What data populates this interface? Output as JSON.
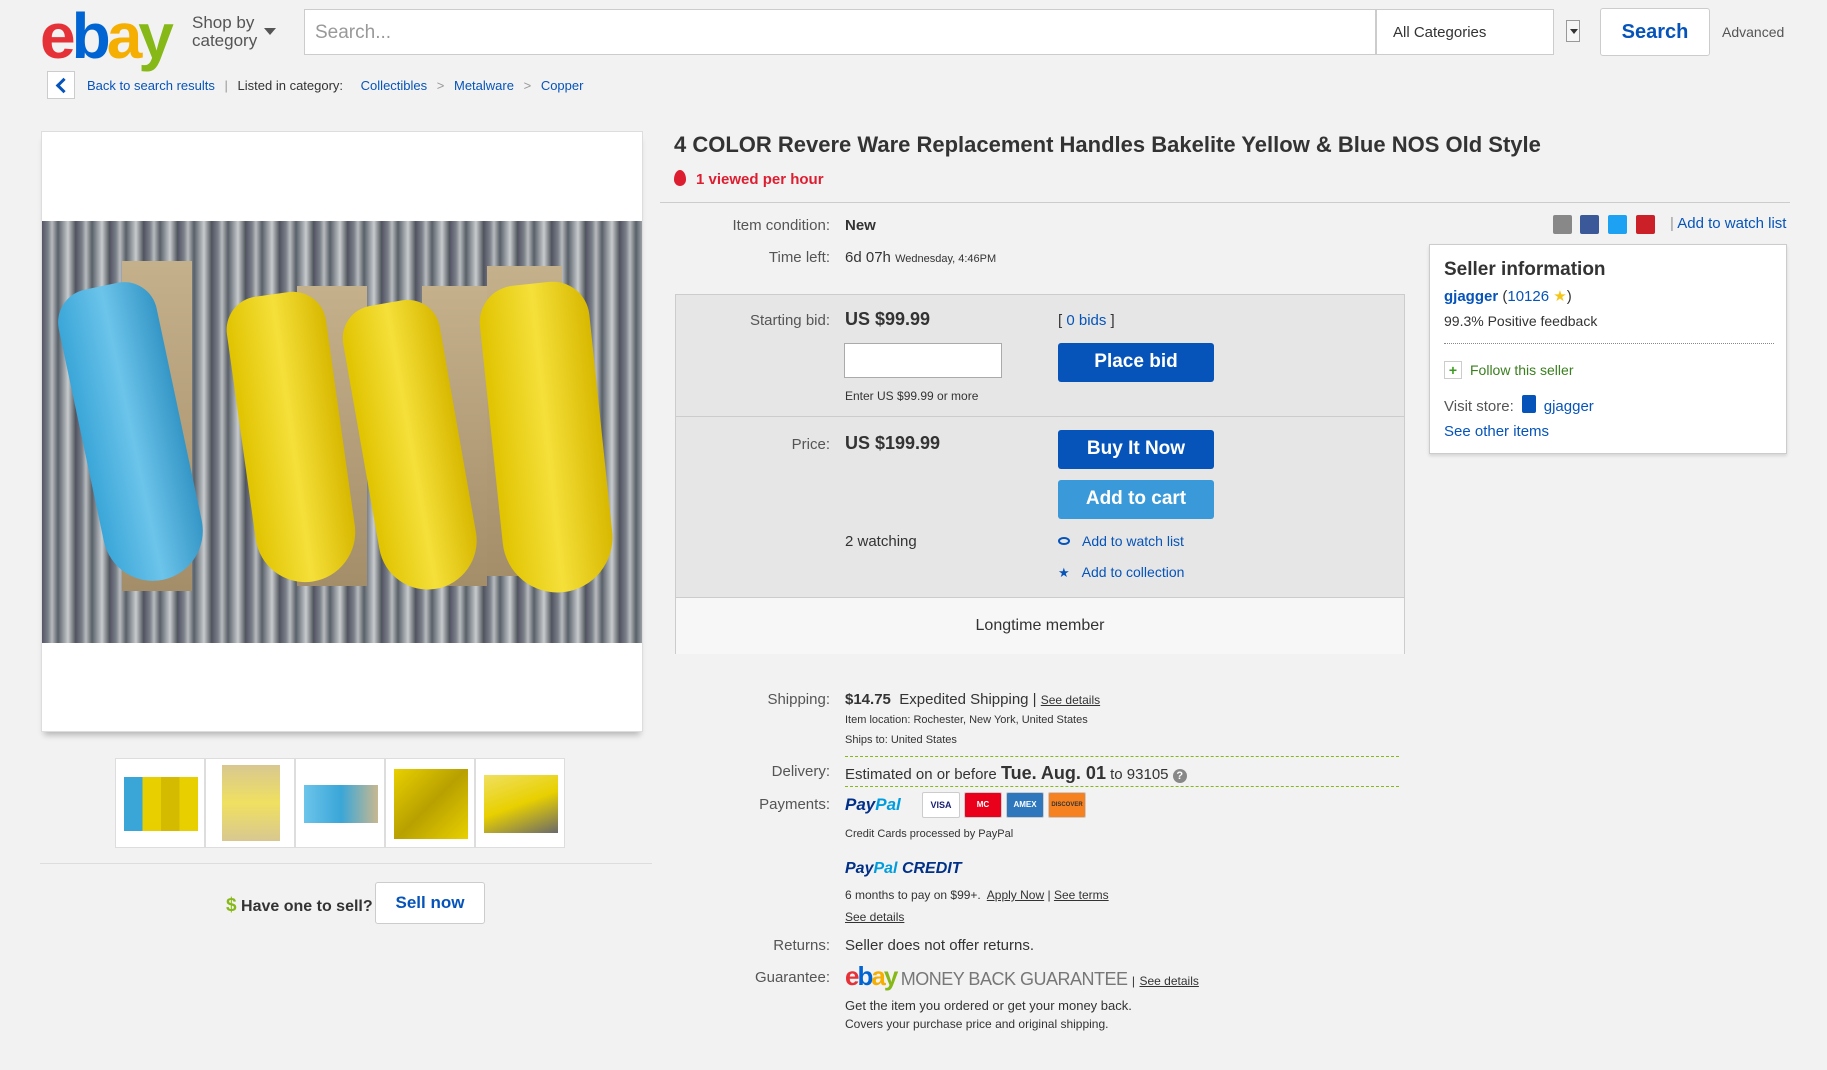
{
  "header": {
    "logo": [
      "e",
      "b",
      "a",
      "y"
    ],
    "shop_by": "Shop by",
    "category": "category",
    "search_placeholder": "Search...",
    "category_select": "All Categories",
    "search_button": "Search",
    "advanced": "Advanced"
  },
  "breadcrumb": {
    "back": "Back to search results",
    "listed_in": "Listed in category:",
    "items": [
      "Collectibles",
      "Metalware",
      "Copper"
    ],
    "separator": ">"
  },
  "listing": {
    "title": "4 COLOR Revere Ware Replacement Handles Bakelite Yellow & Blue NOS Old Style",
    "viewed": "1 viewed per hour",
    "condition_label": "Item condition:",
    "condition_value": "New",
    "time_left_label": "Time left:",
    "time_left_value": "6d 07h",
    "time_left_end": "Wednesday, 4:46PM",
    "add_to_watch_list": "Add to watch list"
  },
  "bidding": {
    "starting_bid_label": "Starting bid:",
    "starting_bid": "US $99.99",
    "bids_open": "[",
    "bids": "0 bids",
    "bids_close": "]",
    "bid_hint": "Enter US $99.99 or more",
    "place_bid": "Place bid",
    "price_label": "Price:",
    "price": "US $199.99",
    "buy_it_now": "Buy It Now",
    "add_to_cart": "Add to cart",
    "watching": "2 watching",
    "add_to_watch_list": "Add to watch list",
    "add_to_collection": "Add to collection",
    "longtime": "Longtime member"
  },
  "seller": {
    "title": "Seller information",
    "name": "gjagger",
    "feedback_open": " (",
    "feedback_score": "10126",
    "feedback_close": ")",
    "positive": "99.3% Positive feedback",
    "follow": "Follow this seller",
    "visit_store": "Visit store:",
    "store_name": "gjagger",
    "other_items": "See other items"
  },
  "shipping": {
    "label": "Shipping:",
    "cost": "$14.75",
    "method": "Expedited Shipping",
    "pipe": "|",
    "see_details": "See details",
    "item_location": "Item location:  Rochester, New York, United States",
    "ships_to": "Ships to:  United States"
  },
  "delivery": {
    "label": "Delivery:",
    "prefix": "Estimated on or before",
    "date": "Tue. Aug. 01",
    "suffix": "to 93105",
    "help": "?"
  },
  "payments": {
    "label": "Payments:",
    "paypal_a": "Pay",
    "paypal_b": "Pal",
    "cards": [
      "VISA",
      "MC",
      "AMEX",
      "DISCOVER"
    ],
    "processed": "Credit Cards processed by PayPal",
    "credit_a": "Pay",
    "credit_b": "Pal",
    "credit_c": "CREDIT",
    "months": "6 months to pay on $99+.",
    "apply": "Apply Now",
    "pipe": "|",
    "see_terms": "See terms",
    "see_details": "See details"
  },
  "returns": {
    "label": "Returns:",
    "value": "Seller does not offer returns."
  },
  "guarantee": {
    "label": "Guarantee:",
    "mbg": "MONEY BACK GUARANTEE",
    "pipe": "|",
    "see_details": "See details",
    "line1": "Get the item you ordered or get your money back.",
    "line2": "Covers your purchase price and original shipping."
  },
  "sell": {
    "dollar": "$",
    "have_one": "Have one to sell?",
    "sell_now": "Sell now"
  },
  "colors": {
    "ebay_red": "#e53238",
    "ebay_blue": "#0064d2",
    "ebay_yellow": "#f5af02",
    "ebay_green": "#86b817",
    "link_blue": "#0654ba",
    "button_blue": "#0654ba",
    "cart_blue": "#3a9ad9",
    "viewed_red": "#dd1e31"
  },
  "icons": [
    "chevron-left-icon",
    "caret-down-icon",
    "flame-icon",
    "email-icon",
    "facebook-icon",
    "twitter-icon",
    "pinterest-icon",
    "eye-icon",
    "star-icon",
    "plus-icon",
    "store-icon",
    "help-icon",
    "dollar-icon"
  ]
}
